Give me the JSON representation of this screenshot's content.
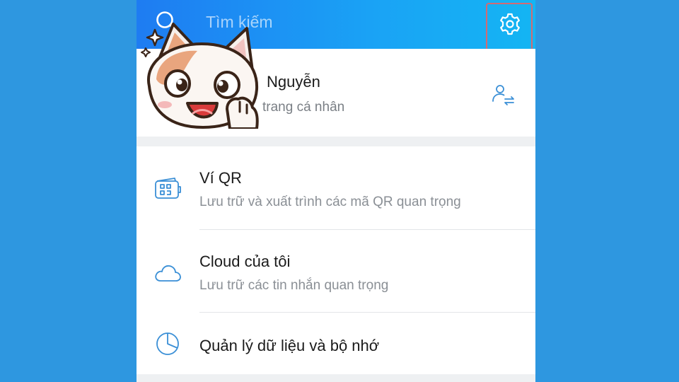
{
  "header": {
    "search_placeholder": "Tìm kiếm",
    "search_icon": "search-icon",
    "settings_icon": "gear-icon",
    "gradient": [
      "#1e7cf2",
      "#14b5f3"
    ]
  },
  "profile": {
    "name": "Nguyễn",
    "subtitle": "trang cá nhân",
    "switch_icon": "switch-account-icon"
  },
  "menu": {
    "items": [
      {
        "title": "Ví QR",
        "subtitle": "Lưu trữ và xuất trình các mã QR quan trọng",
        "icon": "qr-wallet-icon"
      },
      {
        "title": "Cloud của tôi",
        "subtitle": "Lưu trữ các tin nhắn quan trọng",
        "icon": "cloud-icon"
      },
      {
        "title": "Quản lý dữ liệu và bộ nhớ",
        "icon": "pie-chart-icon"
      }
    ]
  },
  "colors": {
    "background": "#2e97e0",
    "highlight_border": "#d36a73",
    "icon_accent": "#3a8fd6"
  }
}
